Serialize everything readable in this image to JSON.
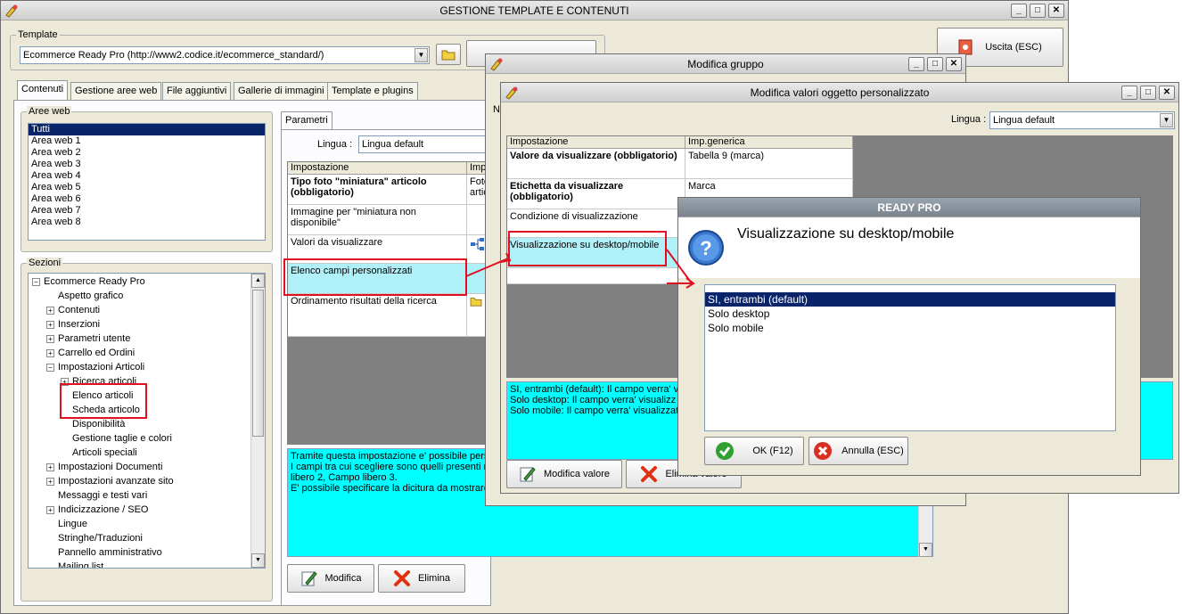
{
  "main_window": {
    "title": "GESTIONE TEMPLATE E CONTENUTI",
    "template_label": "Template",
    "template_value": "Ecommerce Ready Pro (http://www2.codice.it/ecommerce_standard/)",
    "exit_button": "Uscita (ESC)",
    "tabs": [
      "Contenuti",
      "Gestione aree web",
      "File aggiuntivi",
      "Gallerie di immagini",
      "Template e plugins"
    ],
    "aree_web_label": "Aree web",
    "aree_web": [
      "Tutti",
      "Area web 1",
      "Area web 2",
      "Area web 3",
      "Area web 4",
      "Area web 5",
      "Area web 6",
      "Area web 7",
      "Area web 8"
    ],
    "sezioni_label": "Sezioni",
    "tree": [
      "Ecommerce Ready Pro",
      "Aspetto grafico",
      "Contenuti",
      "Inserzioni",
      "Parametri utente",
      "Carrello ed Ordini",
      "Impostazioni Articoli",
      "Ricerca articoli",
      "Elenco articoli",
      "Scheda articolo",
      "Disponibilità",
      "Gestione taglie e colori",
      "Articoli speciali",
      "Impostazioni Documenti",
      "Impostazioni avanzate sito",
      "Messaggi e testi vari",
      "Indicizzazione / SEO",
      "Lingue",
      "Stringhe/Traduzioni",
      "Pannello amministrativo",
      "Mailing list"
    ],
    "params_tab": "Parametri",
    "lingua_label": "Lingua :",
    "lingua_value": "Lingua default",
    "grid_headers": [
      "Impostazione",
      "Imp"
    ],
    "grid_rows": [
      {
        "setting": "Tipo foto \"miniatura\" articolo (obbligatorio)",
        "value": "Foto artic"
      },
      {
        "setting": "Immagine per \"miniatura non disponibile\"",
        "value": ""
      },
      {
        "setting": "Valori da visualizzare",
        "value": ""
      },
      {
        "setting": "Elenco campi personalizzati",
        "value": ""
      },
      {
        "setting": "Ordinamento risultati della ricerca",
        "value": ""
      }
    ],
    "description": "Tramite questa impostazione e' possibile perso\nI campi tra cui scegliere sono quelli presenti ne\nlibero 2, Campo libero 3.\nE' possibile specificare la dicitura da mostrare",
    "modifica_button": "Modifica",
    "elimina_button": "Elimina"
  },
  "group_window": {
    "title": "Modifica gruppo",
    "n_label": "N"
  },
  "custom_window": {
    "title": "Modifica valori oggetto personalizzato",
    "lingua_label": "Lingua :",
    "lingua_value": "Lingua default",
    "grid_headers": [
      "Impostazione",
      "Imp.generica"
    ],
    "grid_rows": [
      {
        "setting": "Valore da visualizzare (obbligatorio)",
        "value": "Tabella 9 (marca)"
      },
      {
        "setting": "Etichetta da visualizzare (obbligatorio)",
        "value": "Marca"
      },
      {
        "setting": "Condizione di visualizzazione",
        "value": ""
      },
      {
        "setting": "Visualizzazione su desktop/mobile",
        "value": ""
      }
    ],
    "description": "SI, entrambi (default): Il campo verra' v\nSolo desktop: Il campo verra' visualizz\nSolo mobile: Il campo verra' visualizzat",
    "modifica_valore_button": "Modifica valore",
    "elimina_valore_button": "Elimina valore"
  },
  "dialog": {
    "title": "READY PRO",
    "question": "Visualizzazione su desktop/mobile",
    "options": [
      "SI, entrambi (default)",
      "Solo desktop",
      "Solo mobile"
    ],
    "selected_option": "SI, entrambi (default)",
    "ok_button": "OK (F12)",
    "cancel_button": "Annulla (ESC)"
  },
  "colors": {
    "annotation_red": "#e01020",
    "selection_blue": "#0a246a",
    "memo_cyan": "#00ffff",
    "highlight_row": "#b0f0f8"
  }
}
